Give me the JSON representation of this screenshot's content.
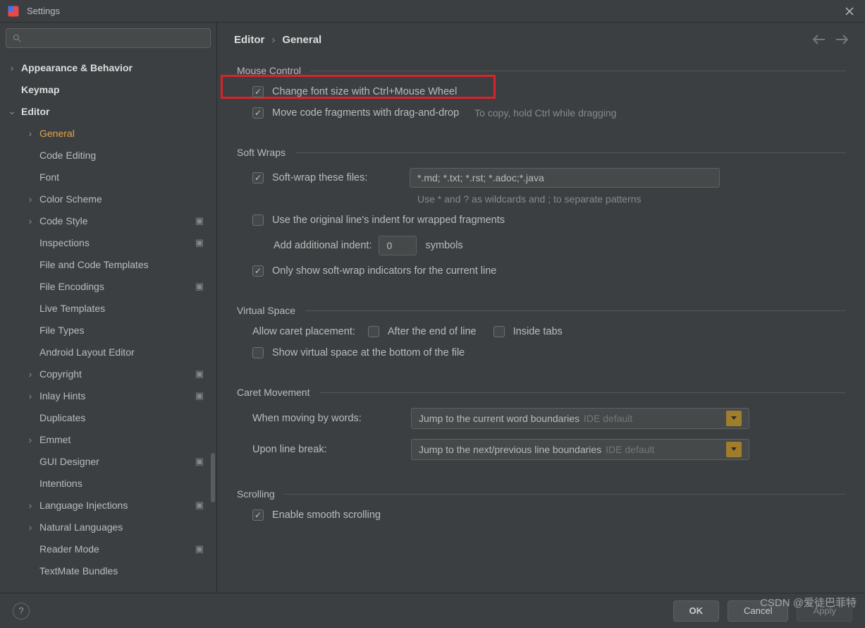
{
  "window": {
    "title": "Settings"
  },
  "breadcrumb": {
    "a": "Editor",
    "b": "General"
  },
  "sidebar": {
    "items": [
      {
        "label": "Appearance & Behavior",
        "chev": ">",
        "bold": true,
        "depth": 0
      },
      {
        "label": "Keymap",
        "chev": "",
        "bold": true,
        "depth": 0
      },
      {
        "label": "Editor",
        "chev": "v",
        "bold": true,
        "depth": 0
      },
      {
        "label": "General",
        "chev": ">",
        "depth": 1,
        "selected": true
      },
      {
        "label": "Code Editing",
        "chev": "",
        "depth": 1
      },
      {
        "label": "Font",
        "chev": "",
        "depth": 1
      },
      {
        "label": "Color Scheme",
        "chev": ">",
        "depth": 1
      },
      {
        "label": "Code Style",
        "chev": ">",
        "depth": 1,
        "sigma": true
      },
      {
        "label": "Inspections",
        "chev": "",
        "depth": 1,
        "sigma": true
      },
      {
        "label": "File and Code Templates",
        "chev": "",
        "depth": 1
      },
      {
        "label": "File Encodings",
        "chev": "",
        "depth": 1,
        "sigma": true
      },
      {
        "label": "Live Templates",
        "chev": "",
        "depth": 1
      },
      {
        "label": "File Types",
        "chev": "",
        "depth": 1
      },
      {
        "label": "Android Layout Editor",
        "chev": "",
        "depth": 1
      },
      {
        "label": "Copyright",
        "chev": ">",
        "depth": 1,
        "sigma": true
      },
      {
        "label": "Inlay Hints",
        "chev": ">",
        "depth": 1,
        "sigma": true
      },
      {
        "label": "Duplicates",
        "chev": "",
        "depth": 1
      },
      {
        "label": "Emmet",
        "chev": ">",
        "depth": 1
      },
      {
        "label": "GUI Designer",
        "chev": "",
        "depth": 1,
        "sigma": true
      },
      {
        "label": "Intentions",
        "chev": "",
        "depth": 1
      },
      {
        "label": "Language Injections",
        "chev": ">",
        "depth": 1,
        "sigma": true
      },
      {
        "label": "Natural Languages",
        "chev": ">",
        "depth": 1
      },
      {
        "label": "Reader Mode",
        "chev": "",
        "depth": 1,
        "sigma": true
      },
      {
        "label": "TextMate Bundles",
        "chev": "",
        "depth": 1
      }
    ]
  },
  "sections": {
    "mouse": {
      "title": "Mouse Control",
      "fontSize": "Change font size with Ctrl+Mouse Wheel",
      "drag": "Move code fragments with drag-and-drop",
      "dragHint": "To copy, hold Ctrl while dragging"
    },
    "soft": {
      "title": "Soft Wraps",
      "wrapFiles": "Soft-wrap these files:",
      "wrapValue": "*.md; *.txt; *.rst; *.adoc;*.java",
      "wrapHint": "Use * and ? as wildcards and ; to separate patterns",
      "origIndent": "Use the original line's indent for wrapped fragments",
      "addIndent": "Add additional indent:",
      "addIndentVal": "0",
      "symbols": "symbols",
      "onlyCurrent": "Only show soft-wrap indicators for the current line"
    },
    "virtual": {
      "title": "Virtual Space",
      "allow": "Allow caret placement:",
      "after": "After the end of line",
      "inside": "Inside tabs",
      "bottom": "Show virtual space at the bottom of the file"
    },
    "caret": {
      "title": "Caret Movement",
      "byWords": "When moving by words:",
      "byWordsVal": "Jump to the current word boundaries",
      "lineBreak": "Upon line break:",
      "lineBreakVal": "Jump to the next/previous line boundaries",
      "ideDefault": "IDE default"
    },
    "scroll": {
      "title": "Scrolling",
      "smooth": "Enable smooth scrolling"
    }
  },
  "footer": {
    "ok": "OK",
    "cancel": "Cancel",
    "apply": "Apply"
  },
  "watermark": "CSDN @爱徒巴菲特"
}
